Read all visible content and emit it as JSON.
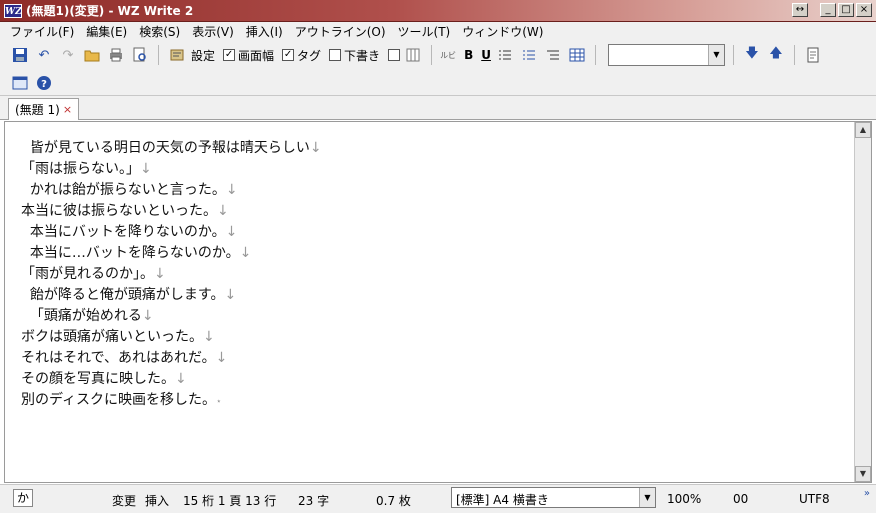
{
  "window": {
    "title": "(無題1)(変更) - WZ Write 2",
    "logo": "WZ",
    "controls": [
      "↔",
      "_",
      "□",
      "×"
    ]
  },
  "menu": [
    "ファイル(F)",
    "編集(E)",
    "検索(S)",
    "表示(V)",
    "挿入(I)",
    "アウトライン(O)",
    "ツール(T)",
    "ウィンドウ(W)"
  ],
  "toolbar": {
    "settings_label": "設定",
    "screen_width_label": "画面幅",
    "screen_width_checked": true,
    "tag_label": "タグ",
    "tag_checked": true,
    "draft_label": "下書き",
    "draft_checked": false,
    "ruby_label": "ルビ",
    "bold_label": "B",
    "underline_label": "U",
    "font_combo_value": ""
  },
  "tabs": [
    {
      "label": "(無題 1)",
      "close": "×"
    }
  ],
  "document": {
    "lines": [
      "  皆が見ている明日の天気の予報は晴天らしい",
      "「雨は振らない。」",
      "  かれは飴が振らないと言った。",
      "本当に彼は振らないといった。",
      "  本当にバットを降りないのか。",
      "  本当に…バットを降らないのか。",
      "「雨が見れるのか」。",
      "  飴が降ると俺が頭痛がします。",
      "  「頭痛が始めれる",
      "ボクは頭痛が痛いといった。",
      "それはそれで、あれはあれだ。",
      "その顔を写真に映した。",
      "別のディスクに映画を移した。"
    ],
    "newline_mark": "↓",
    "eof_mark": "⋆"
  },
  "status": {
    "ime": "か",
    "mode_changed": "変更",
    "mode_insert": "挿入",
    "position": "15 桁 1 頁 13 行",
    "char_count": "23 字",
    "page_count": "0.7 枚",
    "style": "[標準] A4 横書き",
    "zoom": "100%",
    "code": "00",
    "encoding": "UTF8",
    "more": "»"
  }
}
